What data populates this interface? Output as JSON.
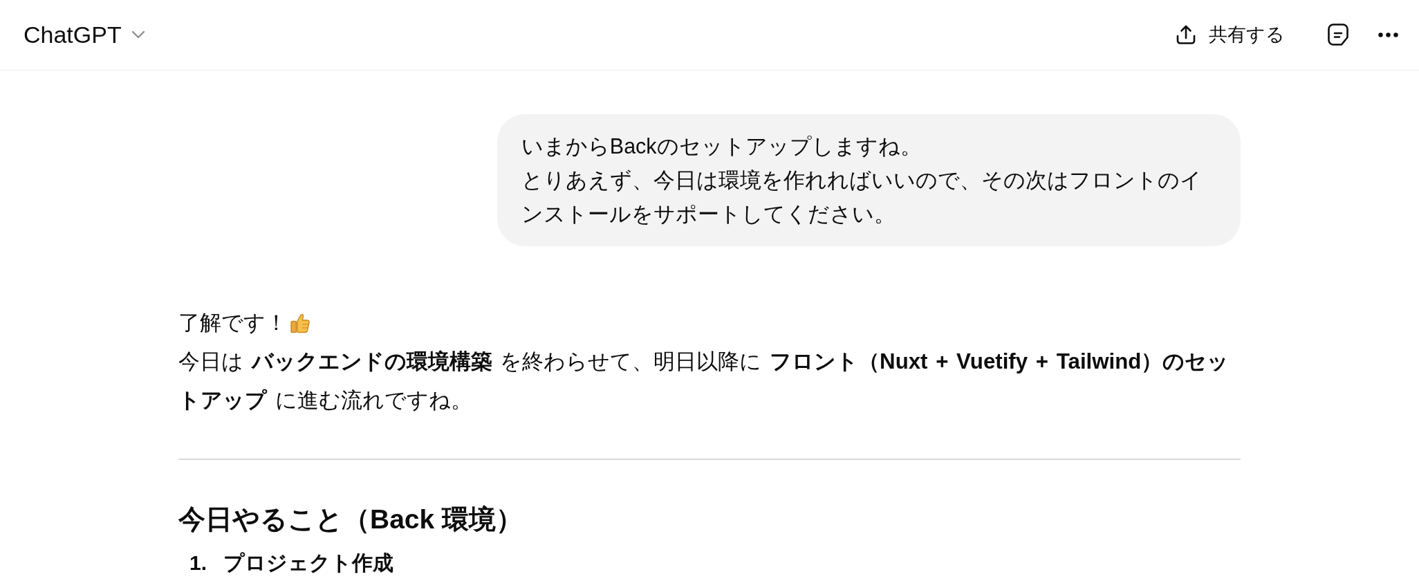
{
  "header": {
    "model_selector": "ChatGPT",
    "share_label": "共有する"
  },
  "user_message": {
    "lines": [
      "いまからBackのセットアップしますね。",
      "とりあえず、今日は環境を作れればいいので、その次はフロントのインストールをサポートしてください。"
    ]
  },
  "assistant_message": {
    "greeting": "了解です！",
    "summary": "今日は **バックエンドの環境構築** を終わらせて、明日以降に **フロント（Nuxt + Vuetify + Tailwind）のセットアップ** に進む流れですね。",
    "section_heading": "今日やること（Back 環境）",
    "steps": [
      {
        "number": "1.",
        "title": "プロジェクト作成"
      }
    ]
  }
}
